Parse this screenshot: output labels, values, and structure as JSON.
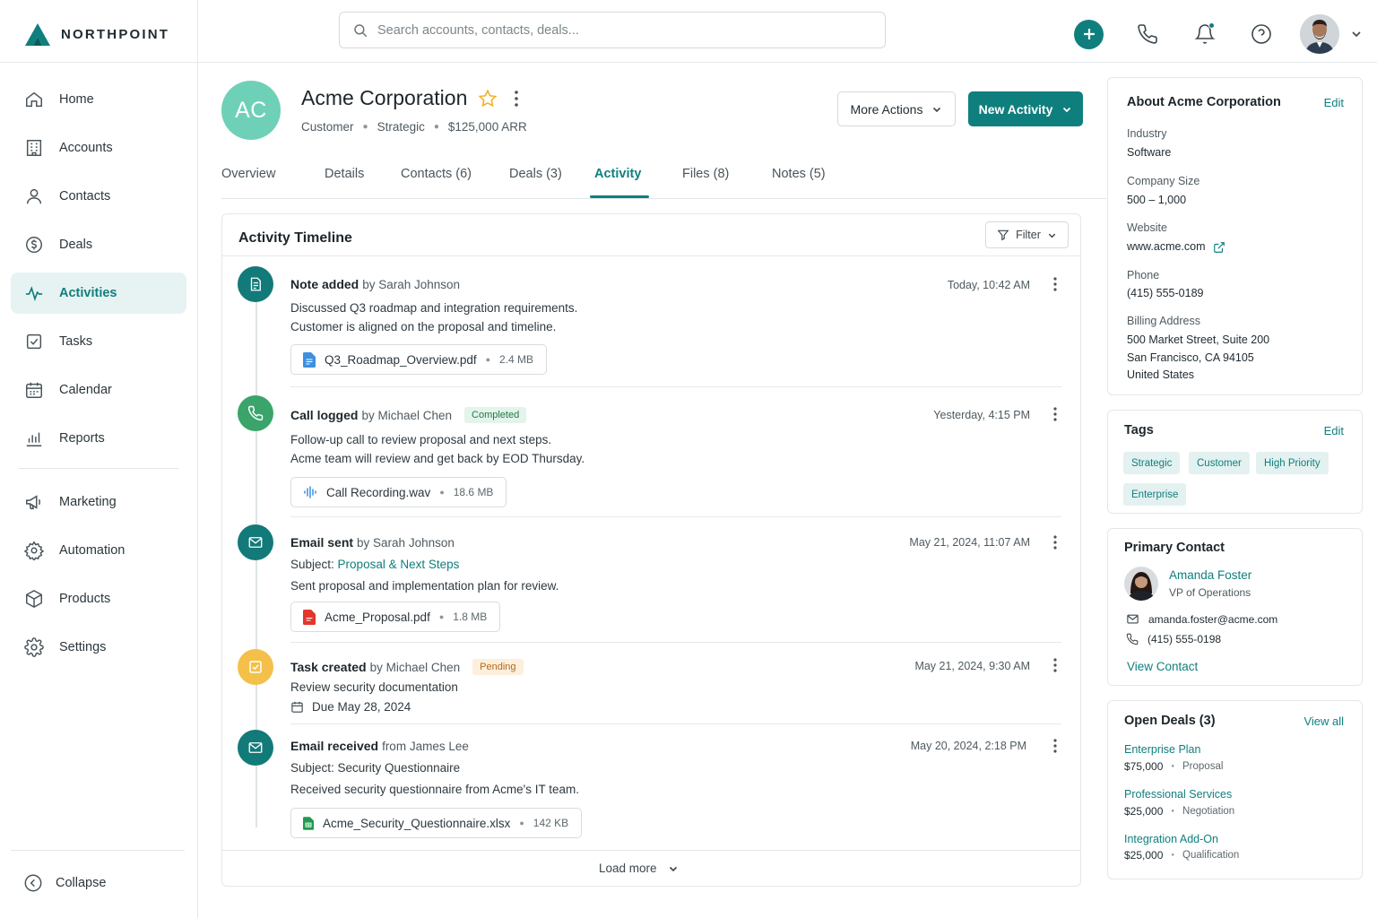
{
  "app": {
    "brand": "NORTHPOINT"
  },
  "search": {
    "placeholder": "Search accounts, contacts, deals..."
  },
  "sidebar": {
    "items": [
      {
        "label": "Home",
        "icon": "home-icon"
      },
      {
        "label": "Accounts",
        "icon": "building-icon"
      },
      {
        "label": "Contacts",
        "icon": "user-icon"
      },
      {
        "label": "Deals",
        "icon": "dollar-icon"
      },
      {
        "label": "Activities",
        "icon": "pulse-icon",
        "active": true
      },
      {
        "label": "Tasks",
        "icon": "checkbox-icon"
      },
      {
        "label": "Calendar",
        "icon": "calendar-icon"
      },
      {
        "label": "Reports",
        "icon": "bar-chart-icon"
      },
      {
        "label": "Marketing",
        "icon": "megaphone-icon"
      },
      {
        "label": "Automation",
        "icon": "gear-icon"
      },
      {
        "label": "Products",
        "icon": "box-icon"
      },
      {
        "label": "Settings",
        "icon": "settings-icon"
      }
    ],
    "collapse_label": "Collapse"
  },
  "account": {
    "initials": "AC",
    "name": "Acme Corporation",
    "type": "Customer",
    "tier": "Strategic",
    "arr": "$125,000 ARR",
    "more_actions_label": "More Actions",
    "new_activity_label": "New Activity"
  },
  "tabs": [
    {
      "label": "Overview"
    },
    {
      "label": "Details"
    },
    {
      "label": "Contacts (6)"
    },
    {
      "label": "Deals (3)"
    },
    {
      "label": "Activity",
      "active": true
    },
    {
      "label": "Files (8)"
    },
    {
      "label": "Notes (5)"
    }
  ],
  "timeline": {
    "title": "Activity Timeline",
    "filter_label": "Filter",
    "load_more_label": "Load more",
    "items": [
      {
        "type_label": "Note added",
        "by": "by Sarah Johnson",
        "time": "Today, 10:42 AM",
        "lines": [
          "Discussed Q3 roadmap and integration requirements.",
          "Customer is aligned on the proposal and timeline."
        ],
        "attachment": {
          "name": "Q3_Roadmap_Overview.pdf",
          "size": "2.4 MB"
        }
      },
      {
        "type_label": "Call logged",
        "by": "by Michael Chen",
        "badge": "Completed",
        "time": "Yesterday, 4:15 PM",
        "lines": [
          "Follow-up call to review proposal and next steps.",
          "Acme team will review and get back by EOD Thursday."
        ],
        "attachment": {
          "name": "Call Recording.wav",
          "size": "18.6 MB"
        }
      },
      {
        "type_label": "Email sent",
        "by": "by Sarah Johnson",
        "time": "May 21, 2024, 11:07 AM",
        "subject_prefix": "Subject:",
        "subject": "Proposal & Next Steps",
        "lines": [
          "Sent proposal and implementation plan for review."
        ],
        "attachment": {
          "name": "Acme_Proposal.pdf",
          "size": "1.8 MB"
        }
      },
      {
        "type_label": "Task created",
        "by": "by Michael Chen",
        "badge": "Pending",
        "time": "May 21, 2024, 9:30 AM",
        "lines": [
          "Review security documentation"
        ],
        "due": "Due May 28, 2024"
      },
      {
        "type_label": "Email received",
        "by": "from James Lee",
        "time": "May 20, 2024, 2:18 PM",
        "subject": "Subject: Security Questionnaire",
        "lines": [
          "Received security questionnaire from Acme's IT team."
        ],
        "attachment": {
          "name": "Acme_Security_Questionnaire.xlsx",
          "size": "142 KB"
        }
      }
    ]
  },
  "about": {
    "title": "About Acme Corporation",
    "edit_label": "Edit",
    "industry_label": "Industry",
    "industry": "Software",
    "size_label": "Company Size",
    "size": "500 – 1,000",
    "website_label": "Website",
    "website": "www.acme.com",
    "phone_label": "Phone",
    "phone": "(415) 555-0189",
    "address_label": "Billing Address",
    "address_line1": "500 Market Street, Suite 200",
    "address_line2": "San Francisco, CA 94105",
    "address_line3": "United States"
  },
  "tags": {
    "title": "Tags",
    "edit_label": "Edit",
    "items": [
      "Strategic",
      "Customer",
      "High Priority",
      "Enterprise"
    ]
  },
  "primary_contact": {
    "title": "Primary Contact",
    "name": "Amanda Foster",
    "role": "VP of Operations",
    "email": "amanda.foster@acme.com",
    "phone": "(415) 555-0198",
    "view_label": "View Contact"
  },
  "open_deals": {
    "title": "Open Deals (3)",
    "view_all_label": "View all",
    "items": [
      {
        "name": "Enterprise Plan",
        "amount": "$75,000",
        "stage": "Proposal"
      },
      {
        "name": "Professional Services",
        "amount": "$25,000",
        "stage": "Negotiation"
      },
      {
        "name": "Integration Add-On",
        "amount": "$25,000",
        "stage": "Qualification"
      }
    ]
  },
  "colors": {
    "accent": "#0f7f7d",
    "avatar": "#6fd0b8",
    "note": "#127a79",
    "call": "#3aa46a",
    "task": "#f4c04a"
  }
}
